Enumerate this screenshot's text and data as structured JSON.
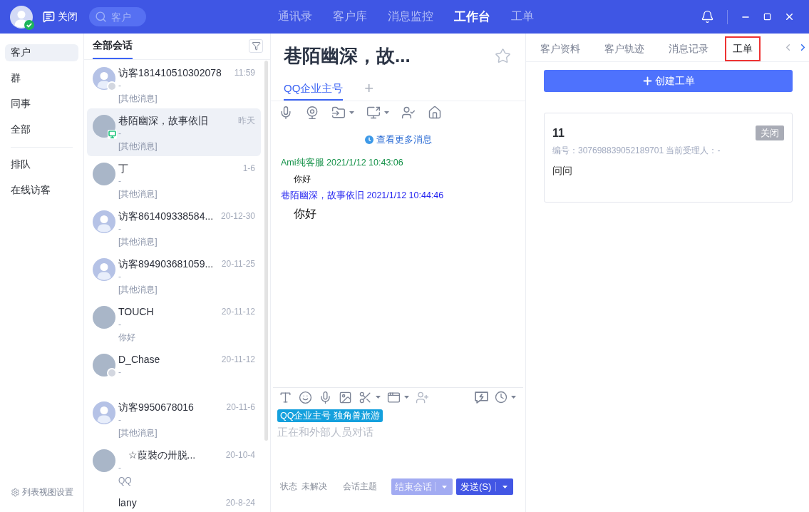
{
  "topbar": {
    "user_online": true,
    "close_label": "关闭",
    "search": {
      "placeholder": "客户"
    },
    "nav": [
      {
        "label": "通讯录",
        "selected": false
      },
      {
        "label": "客户库",
        "selected": false
      },
      {
        "label": "消息监控",
        "selected": false
      },
      {
        "label": "工作台",
        "selected": true
      },
      {
        "label": "工单",
        "selected": false
      }
    ]
  },
  "sidebar": {
    "groups": [
      {
        "items": [
          {
            "label": "客户",
            "selected": true
          },
          {
            "label": "群",
            "selected": false
          },
          {
            "label": "同事",
            "selected": false
          },
          {
            "label": "全部",
            "selected": false
          }
        ]
      },
      {
        "items": [
          {
            "label": "排队",
            "selected": false
          },
          {
            "label": "在线访客",
            "selected": false
          }
        ]
      }
    ],
    "settings_label": "列表视图设置"
  },
  "conversations": {
    "tab": {
      "label": "全部会话",
      "selected": true
    },
    "items": [
      {
        "name": "访客181410510302078",
        "time": "11:59",
        "subtitle": "-",
        "preview": "[其他消息]",
        "avatar": {
          "kind": "default"
        },
        "status": {
          "kind": "offline"
        },
        "selected": false
      },
      {
        "name": "巷陌幽深，故事依旧",
        "time": "昨天",
        "subtitle": "-",
        "preview": "[其他消息]",
        "avatar": {
          "kind": "photo"
        },
        "status": {
          "kind": "pc"
        },
        "selected": true
      },
      {
        "name": "丁",
        "time": "1-6",
        "subtitle": "-",
        "preview": "[其他消息]",
        "avatar": {
          "kind": "photo"
        },
        "selected": false
      },
      {
        "name": "访客861409338584...",
        "time": "20-12-30",
        "subtitle": "-",
        "preview": "[其他消息]",
        "avatar": {
          "kind": "default"
        },
        "selected": false
      },
      {
        "name": "访客894903681059...",
        "time": "20-11-25",
        "subtitle": "-",
        "preview": "[其他消息]",
        "avatar": {
          "kind": "default"
        },
        "selected": false
      },
      {
        "name": "TOUCH",
        "time": "20-11-12",
        "subtitle": "-",
        "preview": "你好",
        "avatar": {
          "kind": "photo"
        },
        "selected": false
      },
      {
        "name": "D_Chase",
        "time": "20-11-12",
        "subtitle": "-",
        "avatar": {
          "kind": "photo"
        },
        "status": {
          "kind": "offline"
        },
        "selected": false
      },
      {
        "name": "访客9950678016",
        "time": "20-11-6",
        "subtitle": "-",
        "preview": "[其他消息]",
        "avatar": {
          "kind": "default"
        },
        "selected": false
      },
      {
        "name": "　☆葭裝の卅脱...",
        "time": "20-10-4",
        "subtitle": "-",
        "preview": "QQ",
        "avatar": {
          "kind": "photo"
        },
        "selected": false
      },
      {
        "name": "lany",
        "time": "20-8-24",
        "selected": false
      }
    ]
  },
  "chat": {
    "title": "巷陌幽深，故...",
    "starred": false,
    "channel_tabs": [
      {
        "label": "QQ企业主号",
        "selected": true
      }
    ],
    "add_tab": "+",
    "load_more": "查看更多消息",
    "messages": [
      {
        "kind": "agent",
        "sender": "Ami纯客服 2021/1/12 10:43:06",
        "text": "你好"
      },
      {
        "kind": "customer",
        "sender": "巷陌幽深，故事依旧 2021/1/12 10:44:46",
        "text": "你好"
      }
    ]
  },
  "composer": {
    "tag": "QQ企业主号 独角兽旅游",
    "placeholder": "正在和外部人员对话",
    "status_label": "状态",
    "status_value": "未解决",
    "topic_label": "会话主题",
    "end_button": {
      "label": "结束会话",
      "disabled": true
    },
    "send_button": {
      "label": "发送(S)",
      "disabled": false
    }
  },
  "details": {
    "tabs": [
      {
        "label": "客户资料",
        "selected": false,
        "highlighted": false
      },
      {
        "label": "客户轨迹",
        "selected": false,
        "highlighted": false
      },
      {
        "label": "消息记录",
        "selected": false,
        "highlighted": false
      },
      {
        "label": "工单",
        "selected": true,
        "highlighted": true
      }
    ],
    "create_button": "创建工单",
    "tickets": [
      {
        "title": "11",
        "status": "关闭",
        "meta": "编号：307698839052189701 当前受理人：-",
        "body": "问问"
      }
    ]
  }
}
